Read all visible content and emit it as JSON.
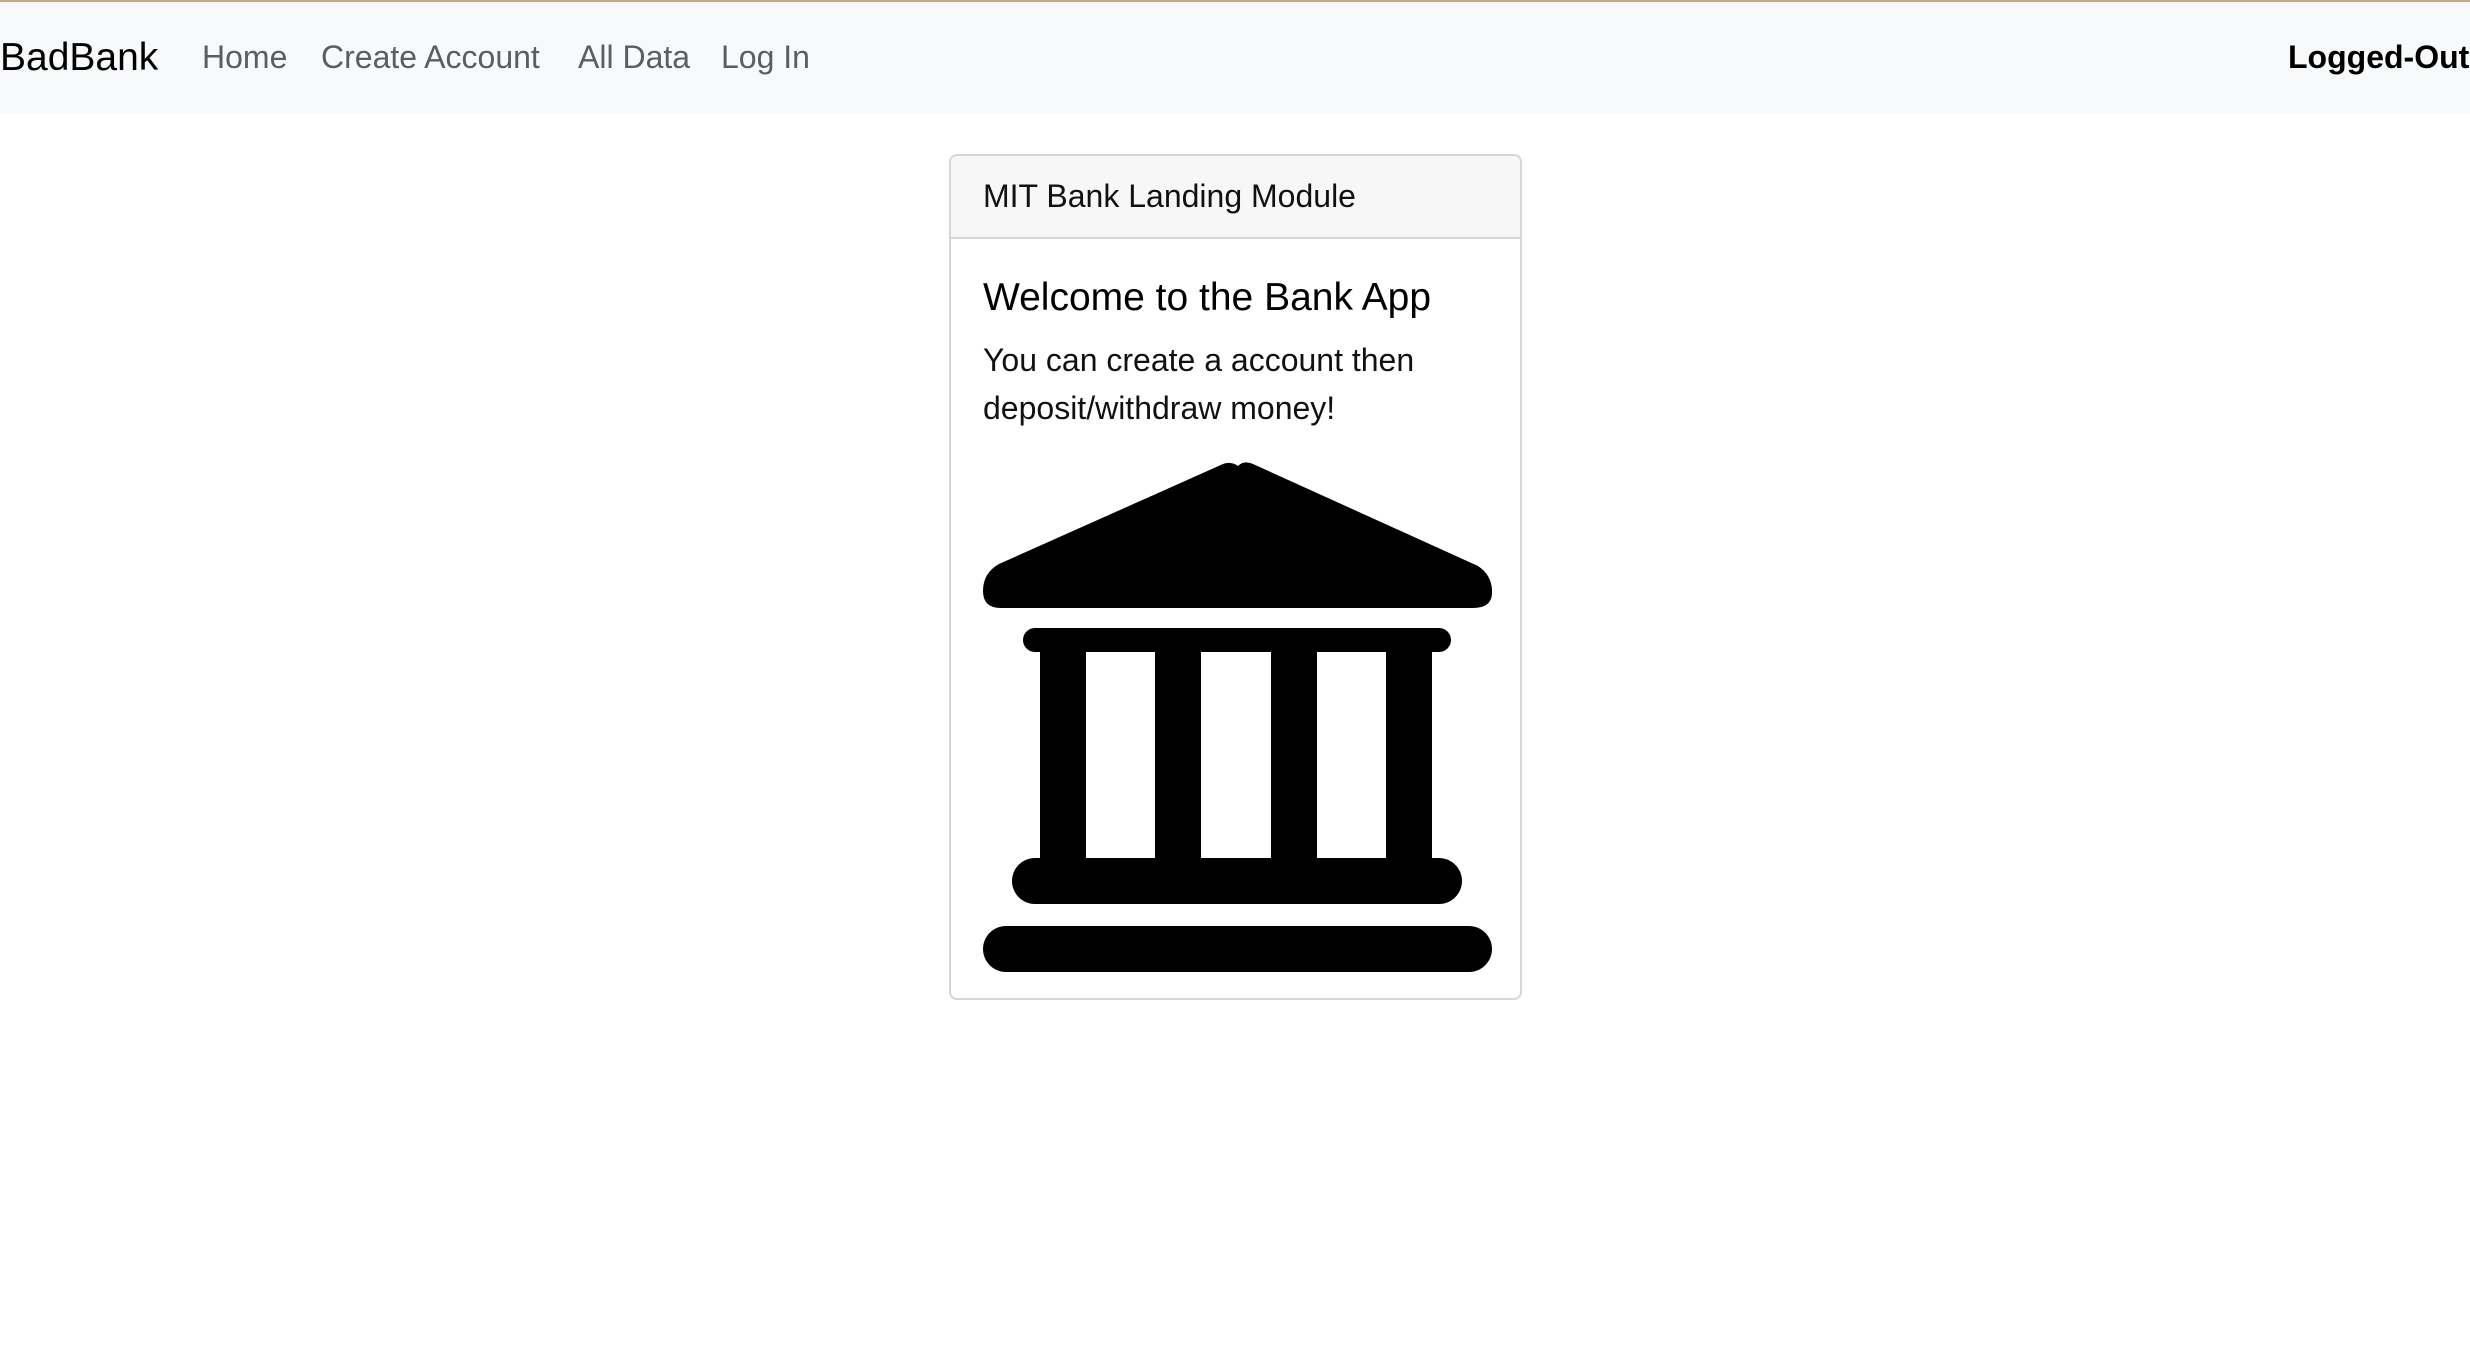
{
  "navbar": {
    "brand": "BadBank",
    "links": [
      {
        "label": "Home"
      },
      {
        "label": "Create Account"
      },
      {
        "label": "All Data"
      },
      {
        "label": "Log In"
      }
    ],
    "status": "Logged-Out"
  },
  "card": {
    "header": "MIT Bank Landing Module",
    "title": "Welcome to the Bank App",
    "text": "You can create a account then deposit/withdraw money!",
    "icon": "bank-building-icon"
  }
}
